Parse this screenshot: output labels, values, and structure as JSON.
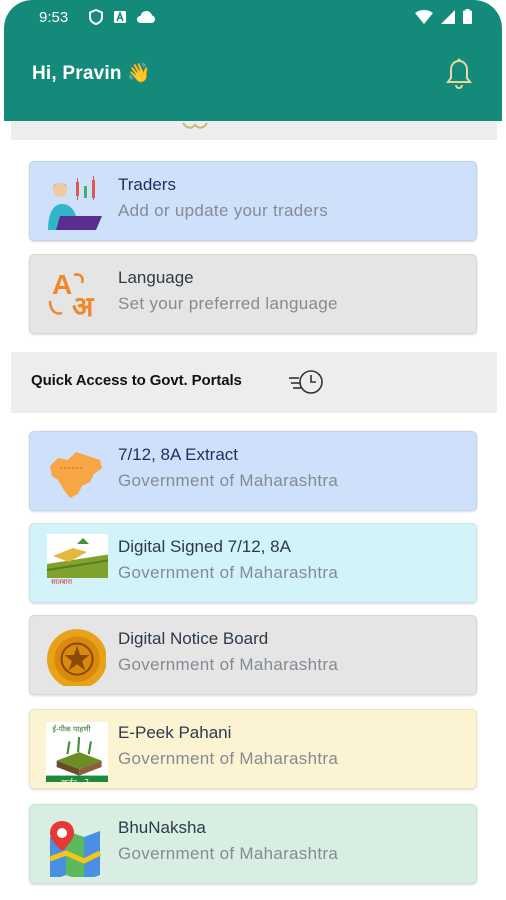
{
  "status_bar": {
    "time": "9:53"
  },
  "header": {
    "greeting": "Hi, Pravin",
    "wave_emoji": "👋"
  },
  "cards_top": [
    {
      "title": "Traders",
      "subtitle": "Add or update your traders",
      "icon": "trader-chart-icon"
    },
    {
      "title": "Language",
      "subtitle": "Set your preferred language",
      "icon": "language-icon"
    }
  ],
  "language_glyph": {
    "a": "A",
    "aa": "अ"
  },
  "quick_access": {
    "title": "Quick Access to Govt. Portals",
    "icon": "history-icon"
  },
  "portals": [
    {
      "title": "7/12, 8A Extract",
      "subtitle": "Government of Maharashtra",
      "icon": "maharashtra-map-icon"
    },
    {
      "title": "Digital Signed 7/12, 8A",
      "subtitle": "Government of Maharashtra",
      "icon": "farm-field-icon"
    },
    {
      "title": "Digital Notice Board",
      "subtitle": "Government of Maharashtra",
      "icon": "state-seal-icon"
    },
    {
      "title": "E-Peek Pahani",
      "subtitle": "Government of Maharashtra",
      "icon": "crop-survey-icon"
    },
    {
      "title": "BhuNaksha",
      "subtitle": "Government of Maharashtra",
      "icon": "map-pin-icon"
    }
  ],
  "colors": {
    "appbar": "#138a7a",
    "card_blue": "#cfe0fb",
    "card_grey": "#e5e5e5",
    "card_cyan": "#d3f3fb",
    "card_cream": "#fcf3d2",
    "card_mint": "#d8eee3"
  }
}
